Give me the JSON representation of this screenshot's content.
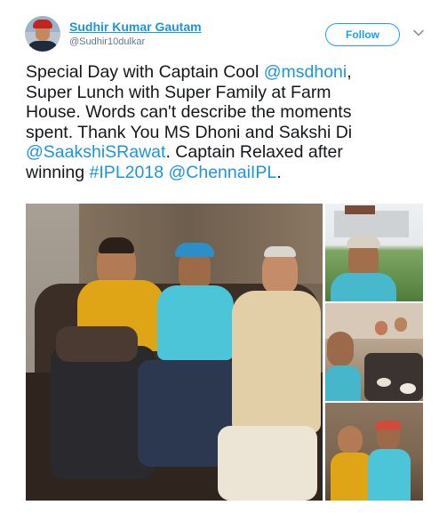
{
  "author": {
    "name": "Sudhir Kumar Gautam",
    "handle": "@Sudhir10dulkar",
    "avatar_icon": "profile-photo"
  },
  "header": {
    "follow_label": "Follow",
    "chevron_icon": "chevron-down-icon"
  },
  "tweet": {
    "lines": [
      [
        {
          "text": "Special Day with Captain Cool ",
          "link": false
        },
        {
          "text": "@msdhoni",
          "link": true
        },
        {
          "text": ",",
          "link": false
        }
      ],
      [
        {
          "text": "Super Lunch with Super Family at Farm",
          "link": false
        }
      ],
      [
        {
          "text": "House. Words can't describe the moments",
          "link": false
        }
      ],
      [
        {
          "text": "spent. Thank You MS Dhoni and Sakshi Di",
          "link": false
        }
      ],
      [
        {
          "text": "@SaakshiSRawat",
          "link": true
        },
        {
          "text": ".  Captain Relaxed after",
          "link": false
        }
      ],
      [
        {
          "text": "winning ",
          "link": false
        },
        {
          "text": "#IPL2018",
          "link": true
        },
        {
          "text": "   ",
          "link": false
        },
        {
          "text": "@ChennaiIPL",
          "link": true
        },
        {
          "text": ".",
          "link": false
        }
      ]
    ]
  },
  "media": {
    "photos": [
      {
        "name": "photo-main",
        "description_icon": "photo-icon"
      },
      {
        "name": "photo-side-1",
        "description_icon": "photo-icon"
      },
      {
        "name": "photo-side-2",
        "description_icon": "photo-icon"
      },
      {
        "name": "photo-side-3",
        "description_icon": "photo-icon"
      }
    ]
  },
  "colors": {
    "link": "#1b95e0",
    "follow_border": "#1da1f2",
    "secondary_text": "#657786",
    "primary_text": "#14171a"
  }
}
